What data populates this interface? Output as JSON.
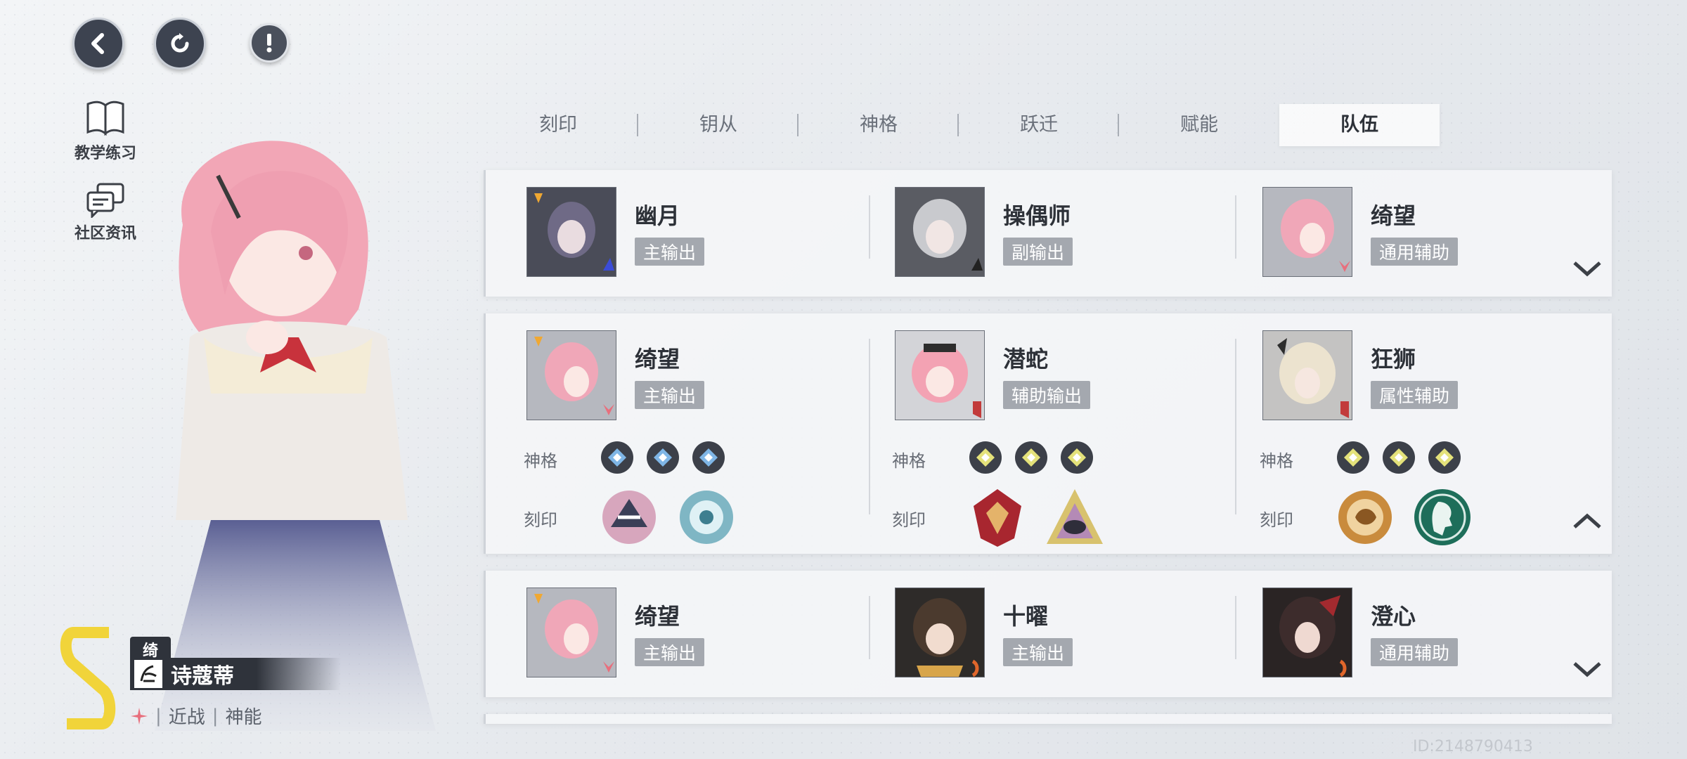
{
  "shortcuts": [
    {
      "label": "教学练习"
    },
    {
      "label": "社区资讯"
    }
  ],
  "character": {
    "nickname": "绮望",
    "name": "诗蔻蒂",
    "attack_type": "近战",
    "class": "神能"
  },
  "tabs": [
    {
      "label": "刻印",
      "active": false
    },
    {
      "label": "钥从",
      "active": false
    },
    {
      "label": "神格",
      "active": false
    },
    {
      "label": "跃迁",
      "active": false
    },
    {
      "label": "赋能",
      "active": false
    },
    {
      "label": "队伍",
      "active": true
    }
  ],
  "teams": [
    {
      "expanded": false,
      "members": [
        {
          "name": "幽月",
          "role": "主输出",
          "portrait_color": "#6f6a86"
        },
        {
          "name": "操偶师",
          "role": "副输出",
          "portrait_color": "#b8b9be"
        },
        {
          "name": "绮望",
          "role": "通用辅助",
          "portrait_color": "#f0a7b8"
        }
      ]
    },
    {
      "expanded": true,
      "labels": {
        "divinity": "神格",
        "seal": "刻印"
      },
      "members": [
        {
          "name": "绮望",
          "role": "主输出",
          "portrait_color": "#f0a7b8",
          "gem_color": "#7fb6e6",
          "seal_colors": [
            "#d7a6bd",
            "#7fb6c4"
          ]
        },
        {
          "name": "潜蛇",
          "role": "辅助输出",
          "portrait_color": "#f3a2b3",
          "gem_color": "#e4e27a",
          "seal_colors": [
            "#a8262f",
            "#d8c26e"
          ]
        },
        {
          "name": "狂狮",
          "role": "属性辅助",
          "portrait_color": "#ece3cf",
          "gem_color": "#e4e27a",
          "seal_colors": [
            "#c98b3d",
            "#1e6e5a"
          ]
        }
      ]
    },
    {
      "expanded": false,
      "members": [
        {
          "name": "绮望",
          "role": "主输出",
          "portrait_color": "#f0a7b8"
        },
        {
          "name": "十曜",
          "role": "主输出",
          "portrait_color": "#4b3a2e"
        },
        {
          "name": "澄心",
          "role": "通用辅助",
          "portrait_color": "#3d2c2c"
        }
      ]
    }
  ],
  "uid": "ID:2148790413"
}
